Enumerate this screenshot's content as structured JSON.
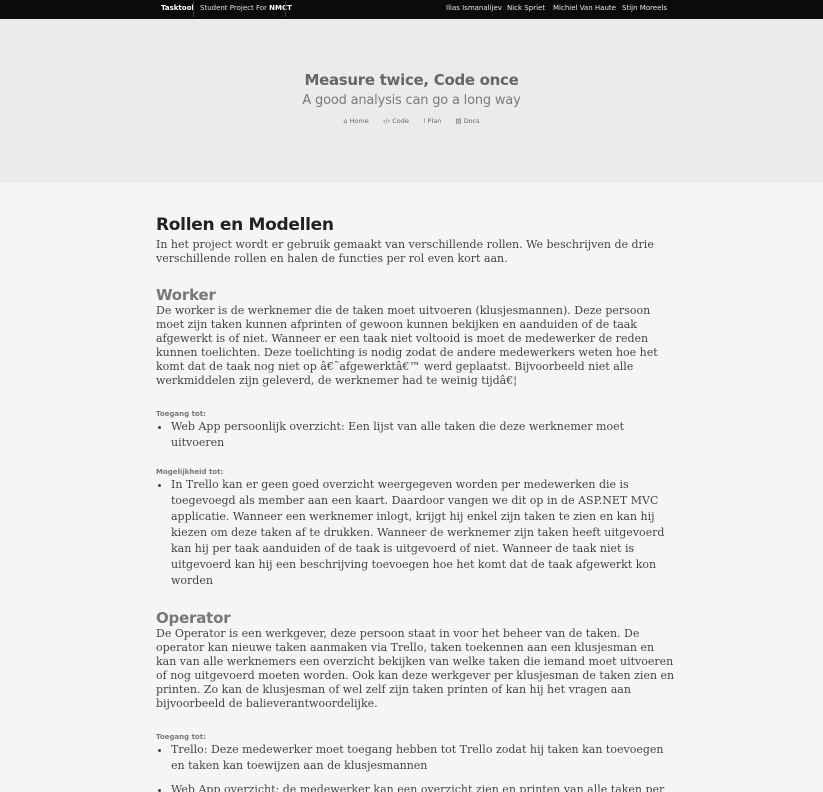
{
  "navbar": {
    "brand": "Tasktool",
    "project_prefix": "Student Project For",
    "project_strong": "NMCT",
    "authors": [
      "Ilias Ismanalijev",
      "Nick Spriet",
      "Michiel Van Haute",
      "Stijn Moreels"
    ]
  },
  "hero": {
    "title": "Measure twice, Code once",
    "subtitle": "A good analysis can go a long way",
    "links": [
      {
        "icon": "home-icon",
        "label": "Home"
      },
      {
        "icon": "code-icon",
        "label": "Code"
      },
      {
        "icon": "plan-icon",
        "label": "Plan"
      },
      {
        "icon": "docs-icon",
        "label": "Docs"
      }
    ]
  },
  "content": {
    "title": "Rollen en Modellen",
    "intro": "In het project wordt er gebruik gemaakt van verschillende rollen. We beschrijven de drie verschillende rollen en halen de functies per rol even kort aan.",
    "worker": {
      "title": "Worker",
      "description": "De worker is de werknemer die de taken moet uitvoeren (klusjesmannen). Deze persoon moet zijn taken kunnen afprinten of gewoon kunnen bekijken en aanduiden of de taak afgewerkt is of niet. Wanneer er een taak niet voltooid is moet de medewerker de reden kunnen toelichten. Deze toelichting is nodig zodat de andere medewerkers weten hoe het komt dat de taak nog niet op â€˜afgewerktâ€™ werd geplaatst. Bijvoorbeeld niet alle werkmiddelen zijn geleverd, de werknemer had te weinig tijdâ€¦",
      "access_label": "Toegang tot:",
      "access_items": [
        "Web App persoonlijk overzicht: Een lijst van alle taken die deze werknemer moet uitvoeren"
      ],
      "possibility_label": "Mogelijkheid tot:",
      "possibility_items": [
        "In Trello kan er geen goed overzicht weergegeven worden per medewerken die is toegevoegd als member aan een kaart. Daardoor vangen we dit op in de ASP.NET MVC applicatie. Wanneer een werknemer inlogt, krijgt hij enkel zijn taken te zien en kan hij kiezen om deze taken af te drukken. Wanneer de werknemer zijn taken heeft uitgevoerd kan hij per taak aanduiden of de taak is uitgevoerd of niet. Wanneer de taak niet is uitgevoerd kan hij een beschrijving toevoegen hoe het komt dat de taak afgewerkt kon worden"
      ]
    },
    "operator": {
      "title": "Operator",
      "description": "De Operator is een werkgever, deze persoon staat in voor het beheer van de taken. De operator kan nieuwe taken aanmaken via Trello, taken toekennen aan een klusjesman en kan van alle werknemers een overzicht bekijken van welke taken die iemand moet uitvoeren of nog uitgevoerd moeten worden. Ook kan deze werkgever per klusjesman de taken zien en printen. Zo kan de klusjesman of wel zelf zijn taken printen of kan hij het vragen aan bijvoorbeeld de balieverantwoordelijke.",
      "access_label": "Toegang tot:",
      "access_items": [
        "Trello: Deze medewerker moet toegang hebben tot Trello zodat hij taken kan toevoegen en taken kan toewijzen aan de klusjesmannen",
        "Web App overzicht: de medewerker kan een overzicht zien en printen van alle taken per klusjesman."
      ]
    }
  }
}
